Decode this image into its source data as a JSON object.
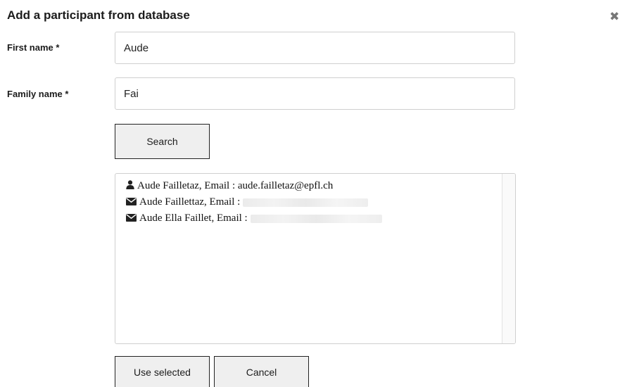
{
  "dialog": {
    "title": "Add a participant from database"
  },
  "form": {
    "first_name": {
      "label": "First name *",
      "value": "Aude"
    },
    "family_name": {
      "label": "Family name *",
      "value": "Fai"
    },
    "search_label": "Search"
  },
  "results": [
    {
      "icon": "user-icon",
      "text": "Aude Failletaz, Email : aude.failletaz@epfl.ch"
    },
    {
      "icon": "envelope-icon",
      "text": "Aude Faillettaz, Email :"
    },
    {
      "icon": "envelope-icon",
      "text": "Aude Ella Faillet, Email :"
    }
  ],
  "actions": {
    "use_selected_label": "Use selected",
    "cancel_label": "Cancel"
  }
}
